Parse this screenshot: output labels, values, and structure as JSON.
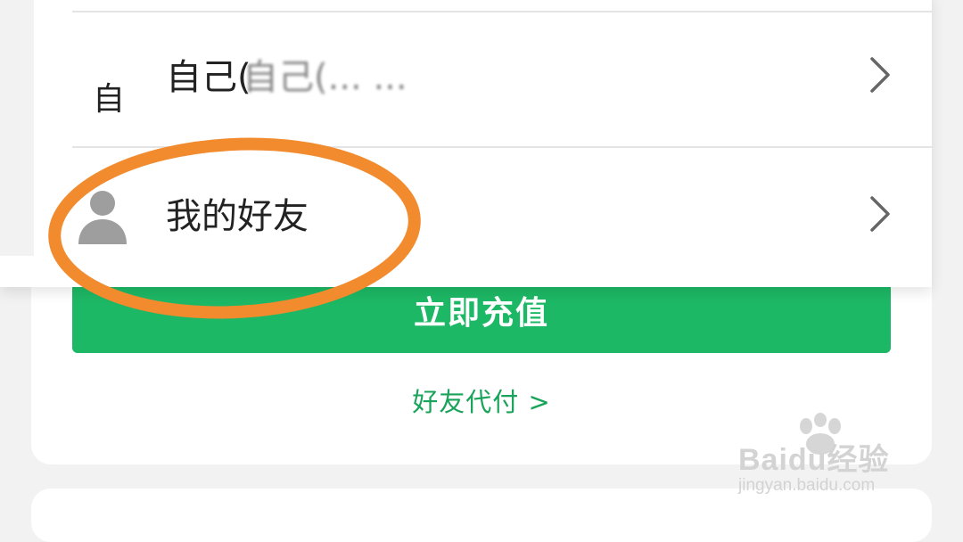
{
  "recharge": {
    "button_label": "立即充值"
  },
  "friend_pay": {
    "link_label": "好友代付 >"
  },
  "sheet": {
    "rows": [
      {
        "avatar_text": "自",
        "label": "自己(",
        "detail": "自己(... ..."
      },
      {
        "label": "我的好友"
      }
    ]
  },
  "watermark": {
    "brand": "Baidu经验",
    "domain": "jingyan.baidu.com"
  },
  "colors": {
    "accent_green": "#1db865",
    "link_green": "#1aa35a",
    "highlight_orange": "#f28a2e"
  },
  "icons": [
    "person-icon",
    "chevron-right-icon",
    "baidu-paw-icon"
  ]
}
